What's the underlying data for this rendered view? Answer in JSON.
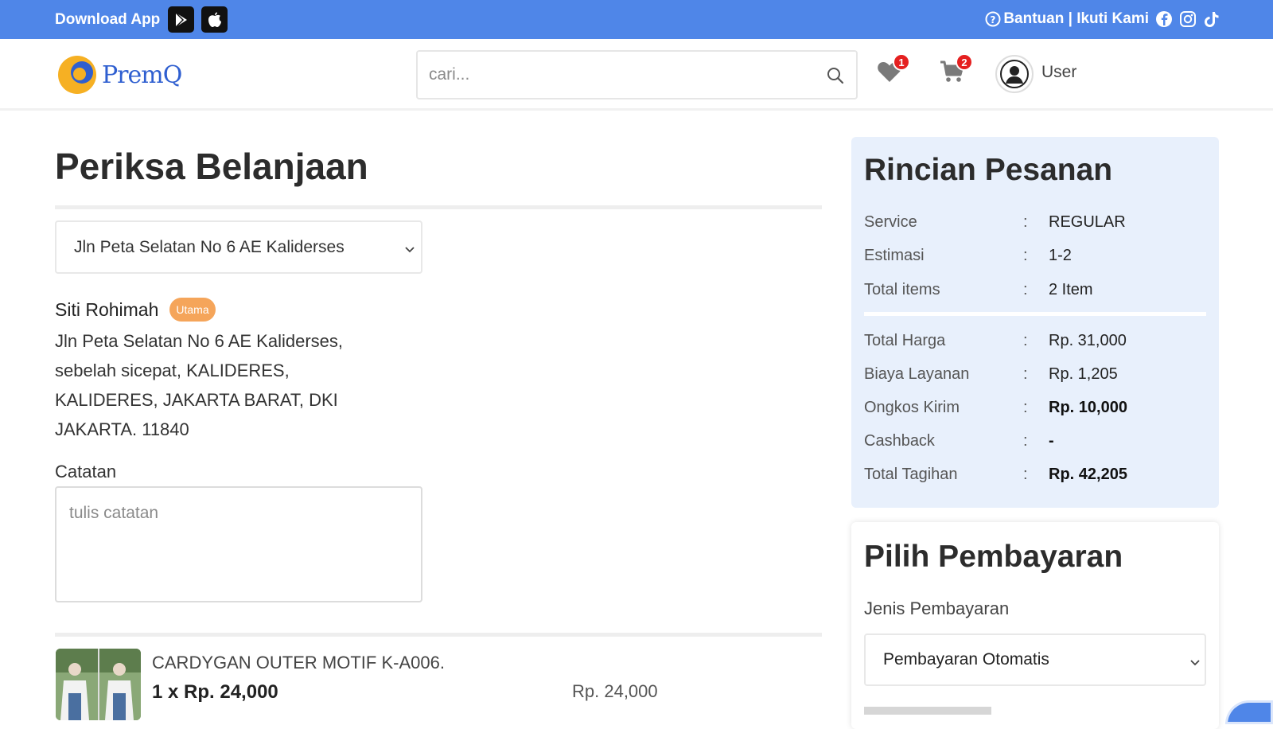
{
  "topbar": {
    "download_label": "Download App",
    "right_text": "Bantuan | Ikuti Kami",
    "icons": [
      "google-play-icon",
      "apple-icon",
      "help-icon",
      "facebook-icon",
      "instagram-icon",
      "tiktok-icon"
    ]
  },
  "header": {
    "logo_text": "PremQ",
    "search_placeholder": "cari...",
    "wishlist_count": "1",
    "cart_count": "2",
    "user_label": "User"
  },
  "checkout": {
    "title": "Periksa Belanjaan",
    "address_selected": "Jln Peta Selatan No 6 AE Kaliderses",
    "recipient_name": "Siti Rohimah",
    "primary_badge": "Utama",
    "address_full": "Jln Peta Selatan No 6 AE Kaliderses, sebelah sicepat, KALIDERES, KALIDERES, JAKARTA BARAT, DKI JAKARTA. 11840",
    "notes_label": "Catatan",
    "notes_placeholder": "tulis catatan",
    "product": {
      "name": "CARDYGAN OUTER MOTIF K-A006.",
      "qty_price": "1 x Rp. 24,000",
      "subtotal": "Rp. 24,000"
    }
  },
  "summary": {
    "title": "Rincian Pesanan",
    "rows": [
      {
        "label": "Service",
        "sep": ":",
        "value": "REGULAR"
      },
      {
        "label": "Estimasi",
        "sep": ":",
        "value": "1-2"
      },
      {
        "label": "Total items",
        "sep": ":",
        "value": "2 Item"
      },
      {
        "label": "Total Harga",
        "sep": ":",
        "value": "Rp. 31,000"
      },
      {
        "label": "Biaya Layanan",
        "sep": ":",
        "value": "Rp. 1,205"
      },
      {
        "label": "Ongkos Kirim",
        "sep": ":",
        "value": "Rp. 10,000"
      },
      {
        "label": "Cashback",
        "sep": ":",
        "value": "-"
      },
      {
        "label": "Total Tagihan",
        "sep": ":",
        "value": "Rp. 42,205"
      }
    ]
  },
  "payment": {
    "title": "Pilih Pembayaran",
    "type_label": "Jenis Pembayaran",
    "type_selected": "Pembayaran Otomatis"
  },
  "colors": {
    "topbar": "#4f86e8",
    "badge": "#e52020",
    "primary_pill": "#f5a55a",
    "summary_bg": "#e8f0fc"
  }
}
